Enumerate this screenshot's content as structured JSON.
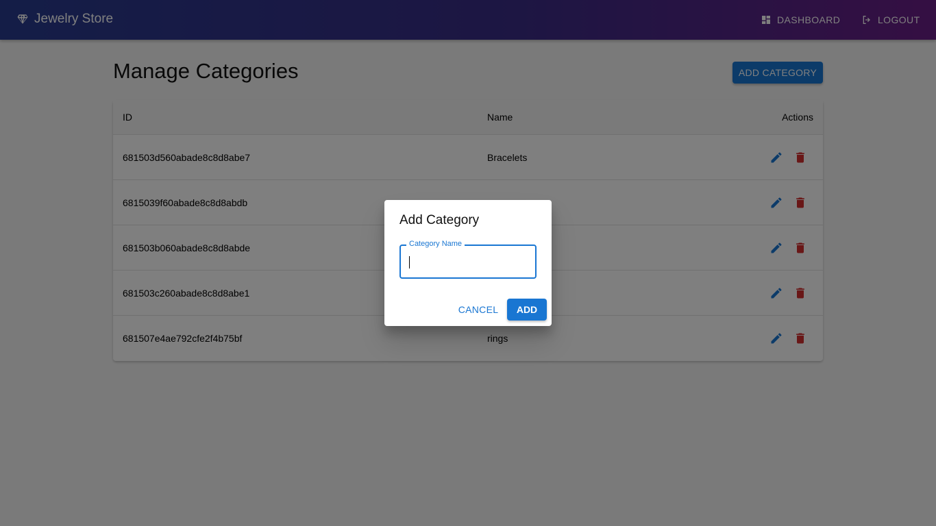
{
  "header": {
    "brand": "Jewelry Store",
    "brand_icon": "diamond-icon",
    "nav": [
      {
        "label": "DASHBOARD",
        "icon": "dashboard-icon"
      },
      {
        "label": "LOGOUT",
        "icon": "logout-icon"
      }
    ]
  },
  "main": {
    "title": "Manage Categories",
    "add_button": "ADD CATEGORY",
    "table": {
      "columns": [
        "ID",
        "Name",
        "Actions"
      ],
      "rows": [
        {
          "id": "681503d560abade8c8d8abe7",
          "name": "Bracelets"
        },
        {
          "id": "6815039f60abade8c8d8abdb",
          "name": ""
        },
        {
          "id": "681503b060abade8c8d8abde",
          "name": ""
        },
        {
          "id": "681503c260abade8c8d8abe1",
          "name": ""
        },
        {
          "id": "681507e4ae792cfe2f4b75bf",
          "name": "rings"
        }
      ]
    }
  },
  "dialog": {
    "title": "Add Category",
    "field_label": "Category Name",
    "field_value": "",
    "cancel": "CANCEL",
    "confirm": "ADD"
  },
  "colors": {
    "primary": "#1976d2",
    "danger": "#d32f2f",
    "header_start": "#283b8f",
    "header_end": "#6a1e86"
  }
}
